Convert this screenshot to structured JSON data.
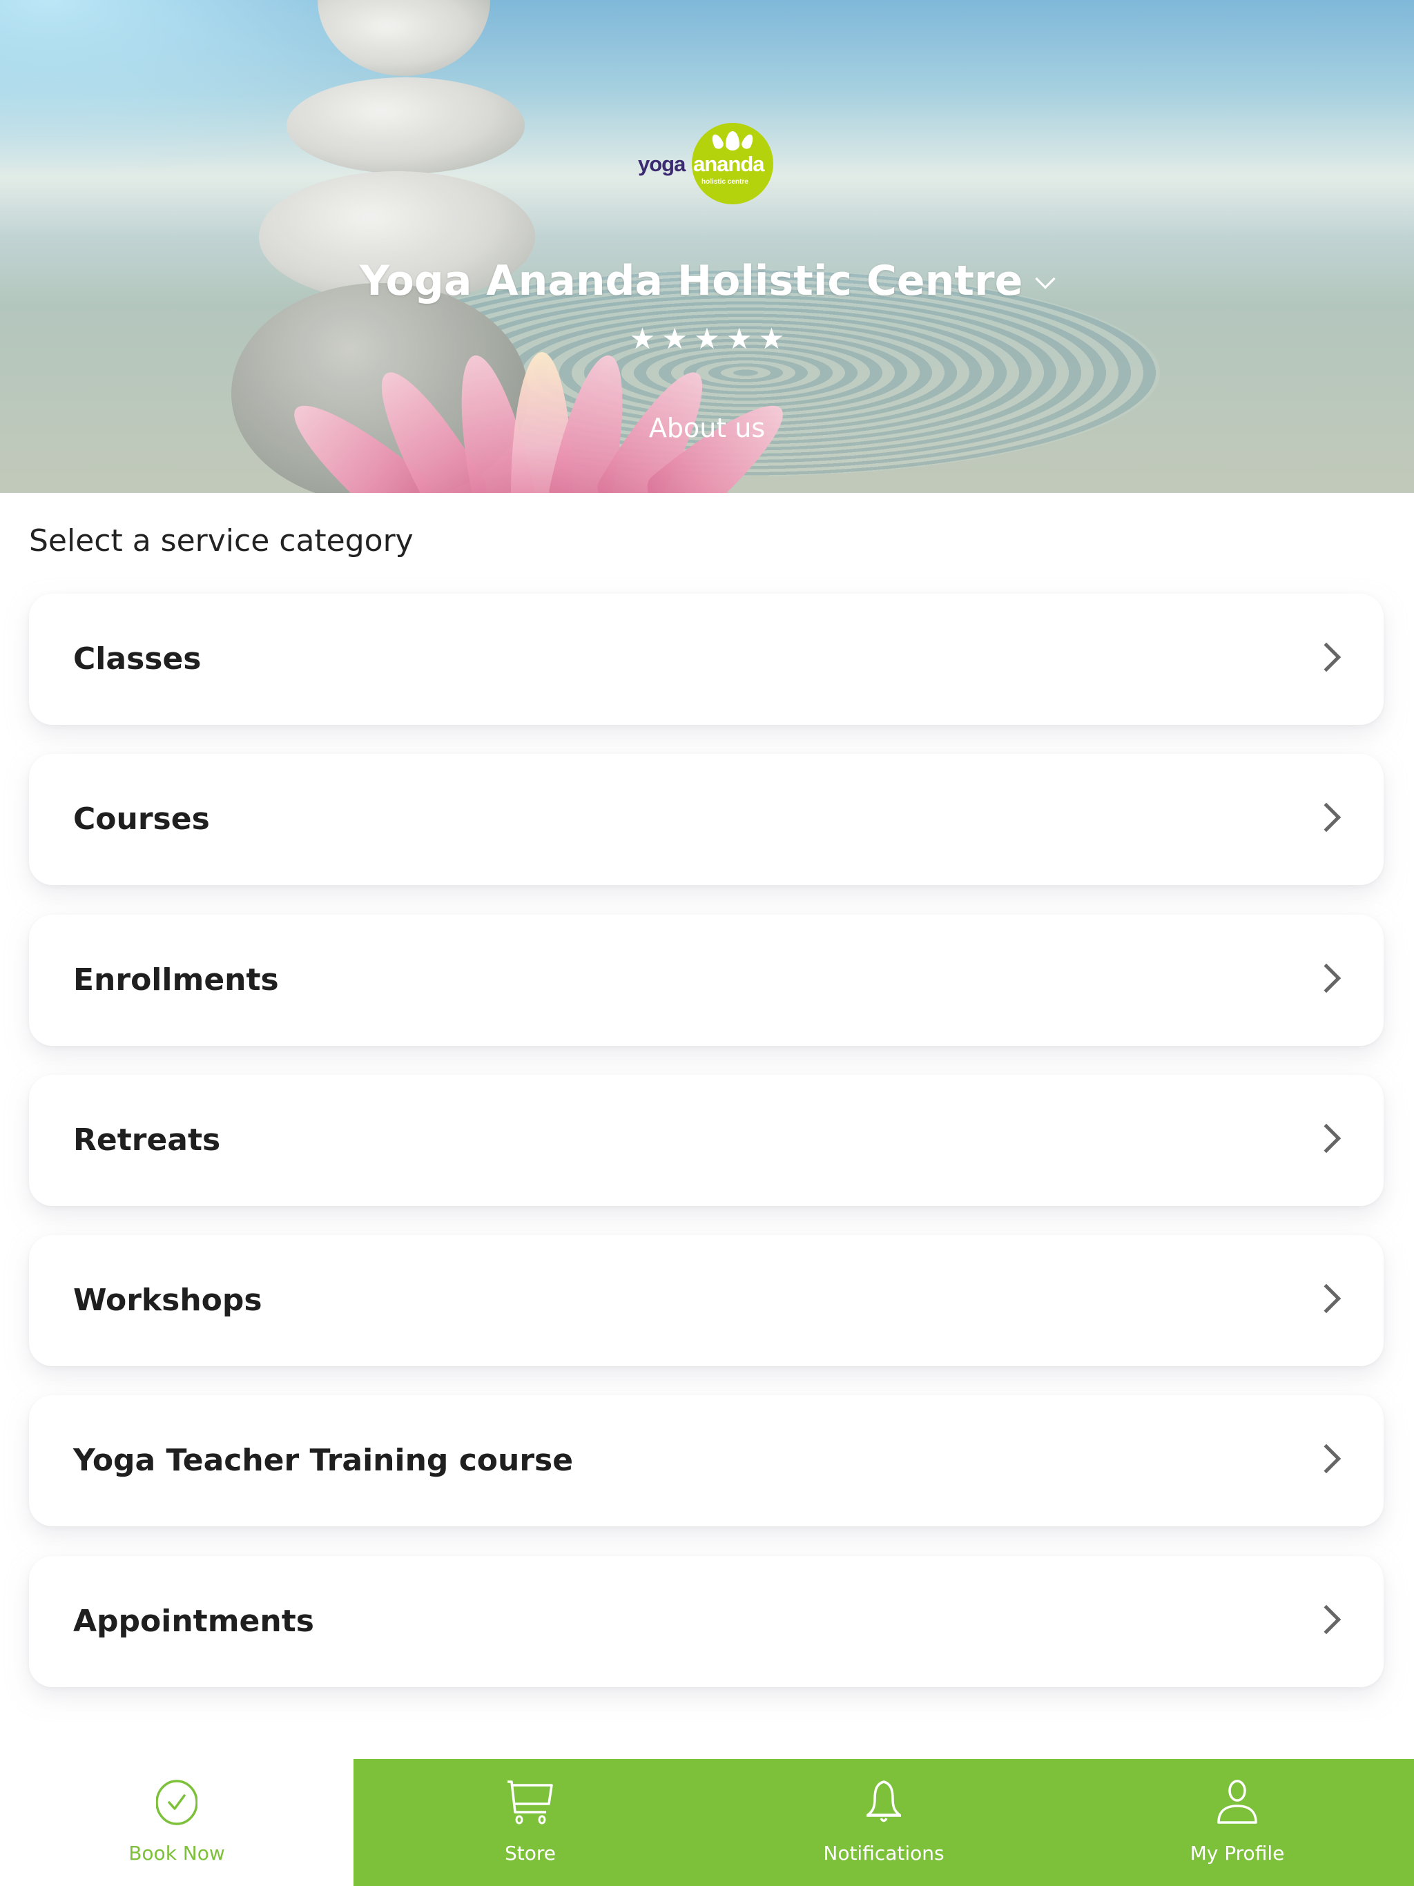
{
  "hero": {
    "logo": {
      "word1": "yoga",
      "word2": "ananda",
      "tagline": "holistic centre"
    },
    "title": "Yoga Ananda Holistic Centre",
    "rating": {
      "stars": 5,
      "max": 5,
      "glyph": "★"
    },
    "about_link": "About us"
  },
  "main": {
    "section_title": "Select a service category",
    "categories": [
      {
        "label": "Classes"
      },
      {
        "label": "Courses"
      },
      {
        "label": "Enrollments"
      },
      {
        "label": "Retreats"
      },
      {
        "label": "Workshops"
      },
      {
        "label": "Yoga Teacher Training course"
      },
      {
        "label": "Appointments"
      }
    ]
  },
  "bottom_nav": {
    "items": [
      {
        "label": "Book Now",
        "icon": "check-circle-icon",
        "active": true
      },
      {
        "label": "Store",
        "icon": "cart-icon",
        "active": false
      },
      {
        "label": "Notifications",
        "icon": "bell-icon",
        "active": false
      },
      {
        "label": "My Profile",
        "icon": "user-icon",
        "active": false
      }
    ]
  },
  "colors": {
    "accent": "#7DC03A",
    "logo_green": "#B5D30C",
    "logo_purple": "#3B2A6F",
    "text": "#1F1F1F",
    "chevron": "#666666"
  }
}
